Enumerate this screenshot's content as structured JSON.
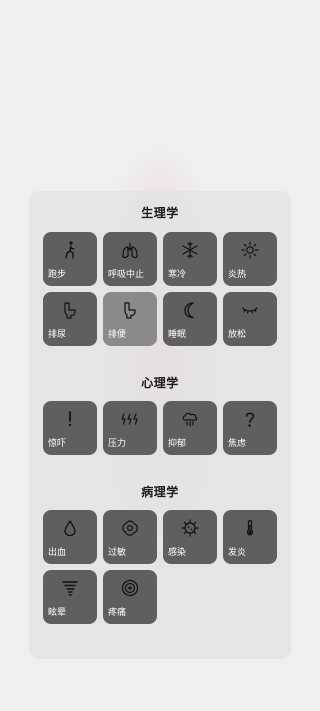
{
  "sections": [
    {
      "title": "生理学",
      "items": [
        {
          "label": "跑步",
          "icon": "walking-person-icon"
        },
        {
          "label": "呼吸中止",
          "icon": "lungs-icon"
        },
        {
          "label": "寒冷",
          "icon": "snowflake-icon"
        },
        {
          "label": "炎热",
          "icon": "sun-icon"
        },
        {
          "label": "排尿",
          "icon": "toilet-icon"
        },
        {
          "label": "排便",
          "icon": "toilet-icon",
          "selected": true
        },
        {
          "label": "睡眠",
          "icon": "moon-icon"
        },
        {
          "label": "放松",
          "icon": "closed-eye-icon"
        }
      ]
    },
    {
      "title": "心理学",
      "items": [
        {
          "label": "惊吓",
          "icon": "exclamation-icon"
        },
        {
          "label": "压力",
          "icon": "lightning-bolts-icon"
        },
        {
          "label": "抑郁",
          "icon": "rain-cloud-icon"
        },
        {
          "label": "焦虑",
          "icon": "question-mark-icon"
        }
      ]
    },
    {
      "title": "病理学",
      "items": [
        {
          "label": "出血",
          "icon": "blood-drop-icon"
        },
        {
          "label": "过敏",
          "icon": "flower-icon"
        },
        {
          "label": "感染",
          "icon": "virus-icon"
        },
        {
          "label": "发炎",
          "icon": "thermometer-icon"
        },
        {
          "label": "眩晕",
          "icon": "tornado-icon"
        },
        {
          "label": "疼痛",
          "icon": "target-icon"
        }
      ]
    }
  ]
}
